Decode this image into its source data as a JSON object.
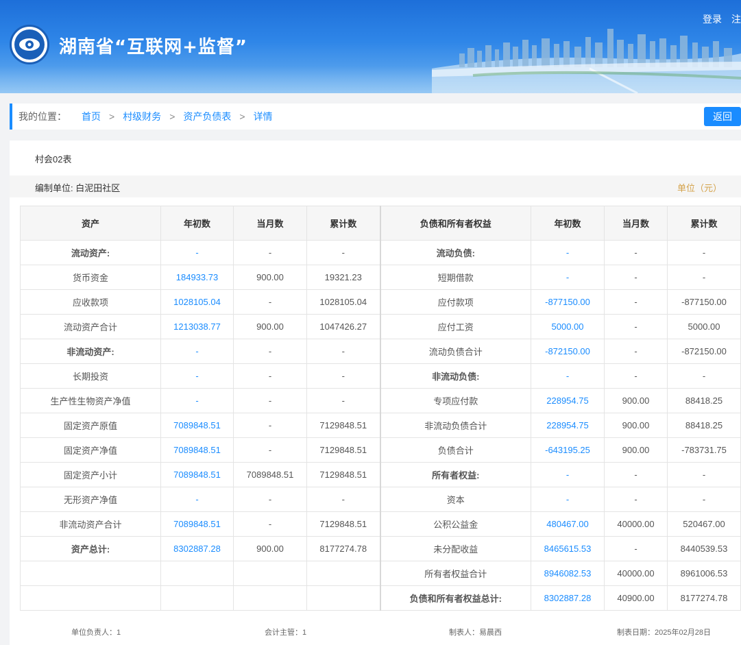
{
  "header": {
    "title": "湖南省“互联网+监督”",
    "login_label": "登录",
    "register_label": "注",
    "logo_icon": "eye-emblem-icon"
  },
  "breadcrumb": {
    "prefix": "我的位置：",
    "items": [
      "首页",
      "村级财务",
      "资产负债表",
      "详情"
    ],
    "separator": ">"
  },
  "back_button": "返回",
  "report": {
    "form_code": "村会02表",
    "org_label": "编制单位: 白泥田社区",
    "unit_label": "单位（元）",
    "columns": [
      "资产",
      "年初数",
      "当月数",
      "累计数",
      "负债和所有者权益",
      "年初数",
      "当月数",
      "累计数"
    ],
    "rows": [
      [
        "流动资产:",
        "-",
        "-",
        "-",
        "流动负债:",
        "-",
        "-",
        "-"
      ],
      [
        "货币资金",
        "184933.73",
        "900.00",
        "19321.23",
        "短期借款",
        "-",
        "-",
        "-"
      ],
      [
        "应收款项",
        "1028105.04",
        "-",
        "1028105.04",
        "应付款项",
        "-877150.00",
        "-",
        "-877150.00"
      ],
      [
        "流动资产合计",
        "1213038.77",
        "900.00",
        "1047426.27",
        "应付工资",
        "5000.00",
        "-",
        "5000.00"
      ],
      [
        "非流动资产:",
        "-",
        "-",
        "-",
        "流动负债合计",
        "-872150.00",
        "-",
        "-872150.00"
      ],
      [
        "长期投资",
        "-",
        "-",
        "-",
        "非流动负债:",
        "-",
        "-",
        "-"
      ],
      [
        "生产性生物资产净值",
        "-",
        "-",
        "-",
        "专项应付款",
        "228954.75",
        "900.00",
        "88418.25"
      ],
      [
        "固定资产原值",
        "7089848.51",
        "-",
        "7129848.51",
        "非流动负债合计",
        "228954.75",
        "900.00",
        "88418.25"
      ],
      [
        "固定资产净值",
        "7089848.51",
        "-",
        "7129848.51",
        "负债合计",
        "-643195.25",
        "900.00",
        "-783731.75"
      ],
      [
        "固定资产小计",
        "7089848.51",
        "7089848.51",
        "7129848.51",
        "所有者权益:",
        "-",
        "-",
        "-"
      ],
      [
        "无形资产净值",
        "-",
        "-",
        "-",
        "资本",
        "-",
        "-",
        "-"
      ],
      [
        "非流动资产合计",
        "7089848.51",
        "-",
        "7129848.51",
        "公积公益金",
        "480467.00",
        "40000.00",
        "520467.00"
      ],
      [
        "资产总计:",
        "8302887.28",
        "900.00",
        "8177274.78",
        "未分配收益",
        "8465615.53",
        "-",
        "8440539.53"
      ],
      [
        "",
        "",
        "",
        "",
        "所有者权益合计",
        "8946082.53",
        "40000.00",
        "8961006.53"
      ],
      [
        "",
        "",
        "",
        "",
        "负债和所有者权益总计:",
        "8302887.28",
        "40900.00",
        "8177274.78"
      ]
    ],
    "bold_left": [
      0,
      4,
      12
    ],
    "bold_right": [
      0,
      5,
      9,
      14
    ]
  },
  "footer": {
    "unit_head": "单位负责人：1",
    "accounting_head": "会计主管：1",
    "preparer": "制表人：易晨西",
    "date": "制表日期：2025年02月28日"
  },
  "colors": {
    "accent": "#1a8cff",
    "header_blue": "#1d6fd9",
    "unit_gold": "#d4a24a"
  }
}
